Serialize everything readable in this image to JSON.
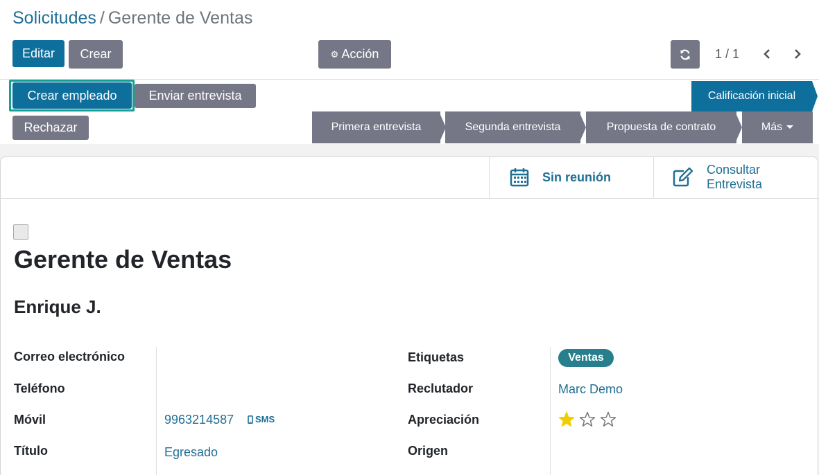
{
  "breadcrumb": {
    "parent": "Solicitudes",
    "separator": "/",
    "current": "Gerente de Ventas"
  },
  "toolbar": {
    "edit_label": "Editar",
    "create_label": "Crear",
    "action_label": "Acción"
  },
  "pager": {
    "value": "1 / 1"
  },
  "header_buttons": {
    "create_employee": "Crear empleado",
    "send_interview": "Enviar entrevista",
    "refuse": "Rechazar"
  },
  "stages": {
    "active": "Calificación inicial",
    "items": [
      "Primera entrevista",
      "Segunda entrevista",
      "Propuesta de contrato",
      "Más"
    ]
  },
  "stat_buttons": {
    "meeting": "Sin reunión",
    "interview_line1": "Consultar",
    "interview_line2": "Entrevista"
  },
  "record": {
    "title": "Gerente de Ventas",
    "applicant": "Enrique J."
  },
  "fields": {
    "email_label": "Correo electrónico",
    "phone_label": "Teléfono",
    "mobile_label": "Móvil",
    "mobile_value": "9963214587",
    "sms_label": "SMS",
    "degree_label": "Título",
    "degree_value": "Egresado",
    "tags_label": "Etiquetas",
    "tag_value": "Ventas",
    "recruiter_label": "Reclutador",
    "recruiter_value": "Marc Demo",
    "priority_label": "Apreciación",
    "priority_stars": 1,
    "priority_max": 3,
    "source_label": "Origen"
  },
  "colors": {
    "primary": "#0f6f9c",
    "secondary": "#767786",
    "link": "#1f6f95",
    "tag": "#277e8c",
    "star": "#f3cc00",
    "focus": "#14a195"
  }
}
